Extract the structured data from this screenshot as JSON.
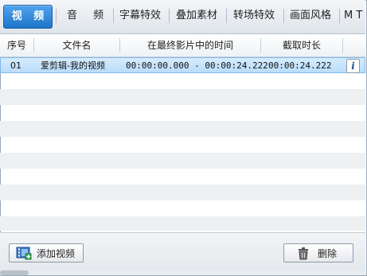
{
  "tabs": [
    {
      "label": "视 频",
      "active": true
    },
    {
      "label": "音 频",
      "active": false
    },
    {
      "label": "字幕特效",
      "active": false
    },
    {
      "label": "叠加素材",
      "active": false
    },
    {
      "label": "转场特效",
      "active": false
    },
    {
      "label": "画面风格",
      "active": false
    },
    {
      "label": "M T",
      "active": false
    }
  ],
  "table": {
    "headers": {
      "index": "序号",
      "filename": "文件名",
      "time_in_final": "在最终影片中的时间",
      "clip_length": "截取时长"
    },
    "rows": [
      {
        "index": "01",
        "filename": "爱剪辑-我的视频",
        "time_in_final": "00:00:00.000 - 00:00:24.222",
        "clip_length": "00:00:24.222",
        "info": "i"
      }
    ]
  },
  "bottom": {
    "add_video_label": "添加视频",
    "delete_label": "删除"
  },
  "colors": {
    "active_tab": "#2b85da",
    "selected_row": "#c6e3fc"
  }
}
